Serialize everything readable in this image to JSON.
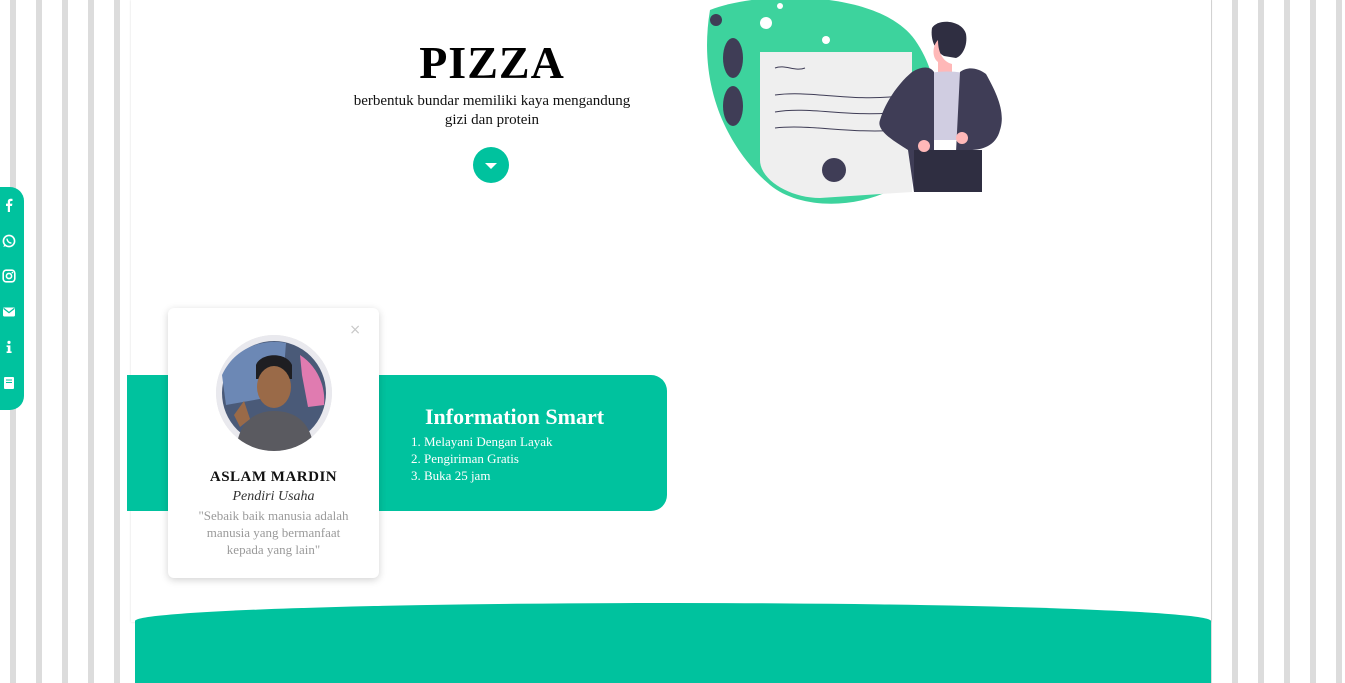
{
  "hero": {
    "title": "PIZZA",
    "subtitle_line1": "berbentuk bundar memiliki kaya mengandung",
    "subtitle_line2": "gizi dan protein"
  },
  "info": {
    "title": "Information Smart",
    "items": [
      "1. Melayani Dengan Layak",
      "2. Pengiriman Gratis",
      "3. Buka 25 jam"
    ]
  },
  "profile": {
    "name": "ASLAM MARDIN",
    "role": "Pendiri Usaha",
    "quote": "\"Sebaik baik manusia adalah manusia yang bermanfaat kepada yang lain\"",
    "close_label": "×"
  },
  "social": {
    "icons": [
      "facebook-icon",
      "whatsapp-icon",
      "instagram-icon",
      "mail-icon",
      "info-icon",
      "book-icon"
    ]
  },
  "colors": {
    "accent": "#00c29e",
    "illustration_green": "#3dd39d",
    "illustration_dark": "#3f3d56"
  }
}
